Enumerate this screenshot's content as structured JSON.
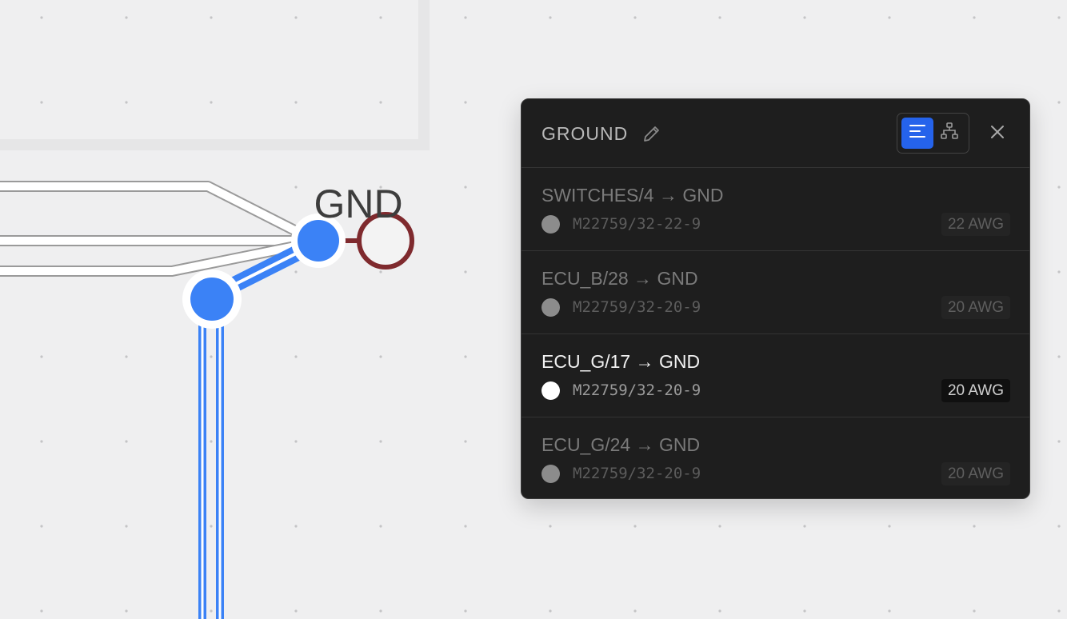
{
  "canvas": {
    "node_label": "GND"
  },
  "panel": {
    "title": "GROUND",
    "view_modes": [
      "list-icon",
      "tree-icon"
    ],
    "active_view": "list",
    "close_icon": "close-icon",
    "edit_icon": "pencil-icon",
    "connections": [
      {
        "name": "SWITCHES/4 → GND",
        "spec": "M22759/32-22-9",
        "gauge": "22 AWG",
        "active": false
      },
      {
        "name": "ECU_B/28 → GND",
        "spec": "M22759/32-20-9",
        "gauge": "20 AWG",
        "active": false
      },
      {
        "name": "ECU_G/17 → GND",
        "spec": "M22759/32-20-9",
        "gauge": "20 AWG",
        "active": true
      },
      {
        "name": "ECU_G/24 → GND",
        "spec": "M22759/32-20-9",
        "gauge": "20 AWG",
        "active": false
      }
    ]
  },
  "colors": {
    "accent": "#2563eb",
    "wire_blue": "#3b82f6",
    "ground_node": "#7f2a2e",
    "panel_bg": "#1e1e1e"
  }
}
